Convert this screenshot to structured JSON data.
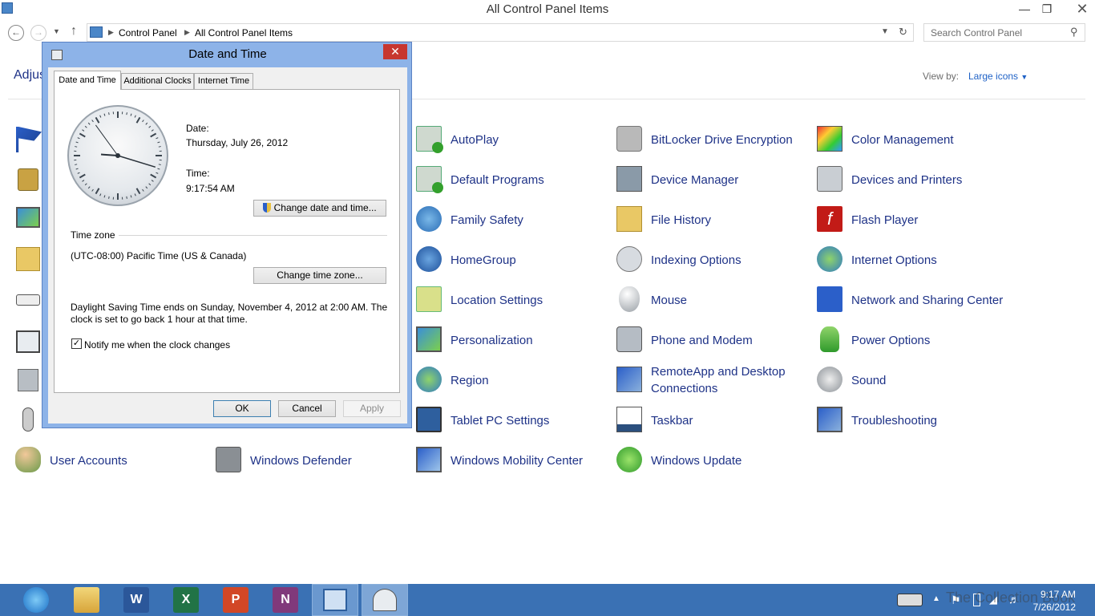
{
  "window": {
    "title": "All Control Panel Items",
    "minimize": "—",
    "restore": "❐",
    "close": "✕"
  },
  "address": {
    "crumb1": "Control Panel",
    "crumb2": "All Control Panel Items",
    "search_placeholder": "Search Control Panel"
  },
  "header": {
    "adjust": "Adjus",
    "view_by": "View by:",
    "view_value": "Large icons"
  },
  "items": {
    "autoplay": "AutoPlay",
    "bitlocker": "BitLocker Drive Encryption",
    "color": "Color Management",
    "default": "Default Programs",
    "device_mgr": "Device Manager",
    "devices_printers": "Devices and Printers",
    "family": "Family Safety",
    "file_history": "File History",
    "flash": "Flash Player",
    "homegroup": "HomeGroup",
    "indexing": "Indexing Options",
    "internet": "Internet Options",
    "location": "Location Settings",
    "mouse": "Mouse",
    "network": "Network and Sharing Center",
    "personalization": "Personalization",
    "phone": "Phone and Modem",
    "power": "Power Options",
    "region": "Region",
    "remoteapp": "RemoteApp and Desktop Connections",
    "sound": "Sound",
    "tablet": "Tablet PC Settings",
    "taskbar": "Taskbar",
    "troubleshooting": "Troubleshooting",
    "user_accounts": "User Accounts",
    "defender": "Windows Defender",
    "mobility": "Windows Mobility Center",
    "update": "Windows Update"
  },
  "dialog": {
    "title": "Date and Time",
    "close": "✕",
    "tabs": [
      "Date and Time",
      "Additional Clocks",
      "Internet Time"
    ],
    "date_label": "Date:",
    "date_value": "Thursday, July 26, 2012",
    "time_label": "Time:",
    "time_value": "9:17:54 AM",
    "change_dt": "Change date and time...",
    "tz_label": "Time zone",
    "tz_value": "(UTC-08:00) Pacific Time (US & Canada)",
    "change_tz": "Change time zone...",
    "dst_line1": "Daylight Saving Time ends on Sunday, November 4, 2012 at 2:00 AM. The",
    "dst_line2": "clock is set to go back 1 hour at that time.",
    "notify": "Notify me when the clock changes",
    "notify_checked": true,
    "ok": "OK",
    "cancel": "Cancel",
    "apply": "Apply"
  },
  "taskbar": {
    "time": "9:17 AM",
    "date": "7/26/2012",
    "watermark": "The Collection Book"
  },
  "colors": {
    "link": "#1e3287",
    "taskbar": "#3a71b4",
    "dialog_frame": "#8db3e8",
    "close_red": "#c7372f"
  }
}
